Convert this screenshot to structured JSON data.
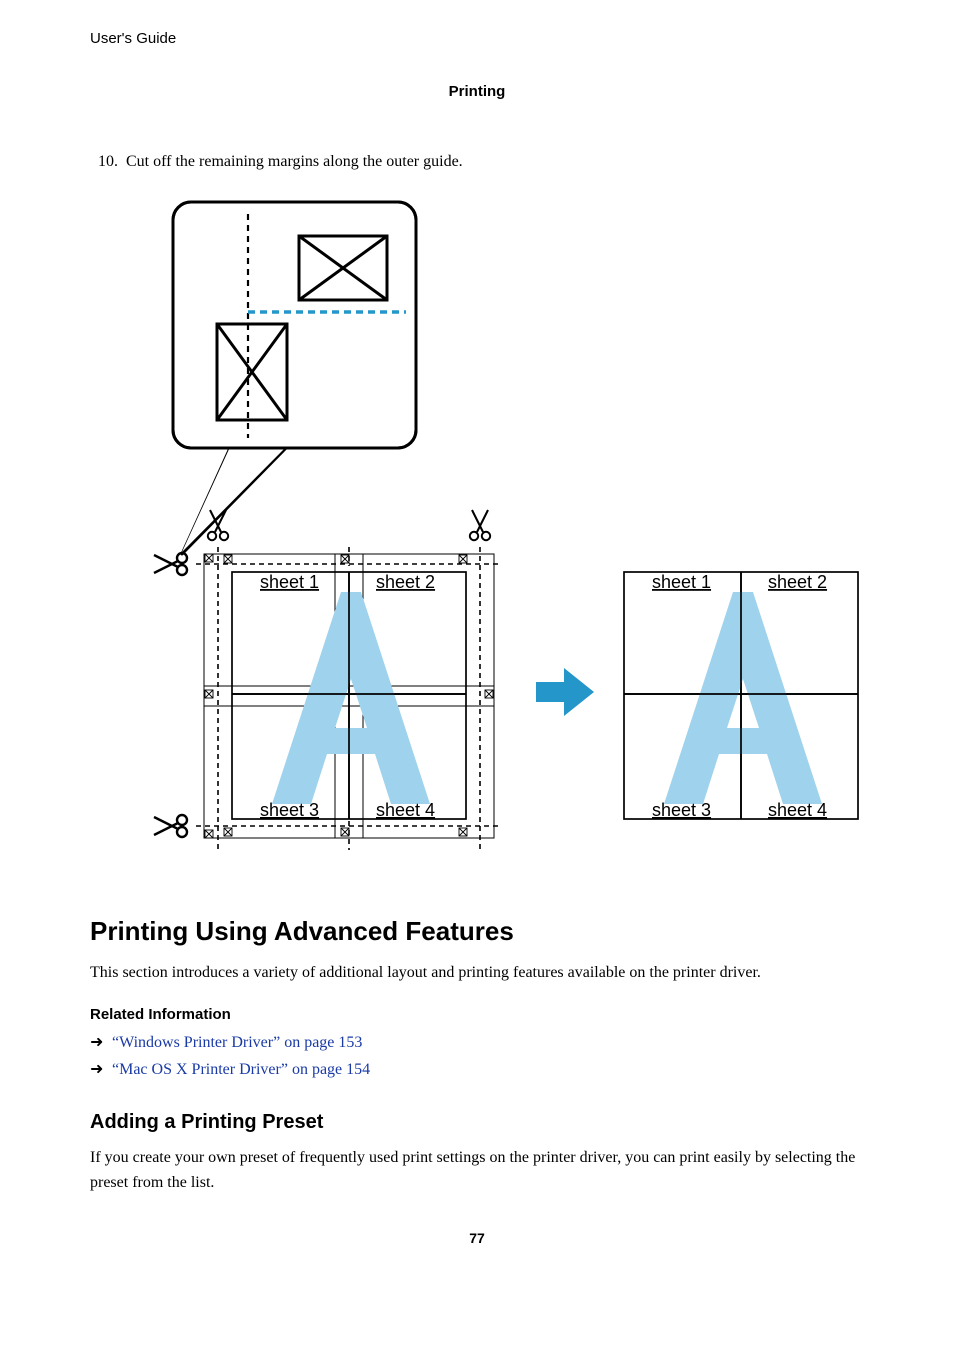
{
  "header": {
    "guide": "User's Guide",
    "section": "Printing"
  },
  "step": {
    "number": "10.",
    "text": "Cut off the remaining margins along the outer guide."
  },
  "figure": {
    "sheet1": "sheet 1",
    "sheet2": "sheet 2",
    "sheet3": "sheet 3",
    "sheet4": "sheet 4"
  },
  "h2": "Printing Using Advanced Features",
  "intro": "This section introduces a variety of additional layout and printing features available on the printer driver.",
  "related": {
    "heading": "Related Information",
    "items": [
      "“Windows Printer Driver” on page 153",
      "“Mac OS X Printer Driver” on page 154"
    ]
  },
  "h3": "Adding a Printing Preset",
  "preset_text": "If you create your own preset of frequently used print settings on the printer driver, you can print easily by selecting the preset from the list.",
  "page_number": "77"
}
